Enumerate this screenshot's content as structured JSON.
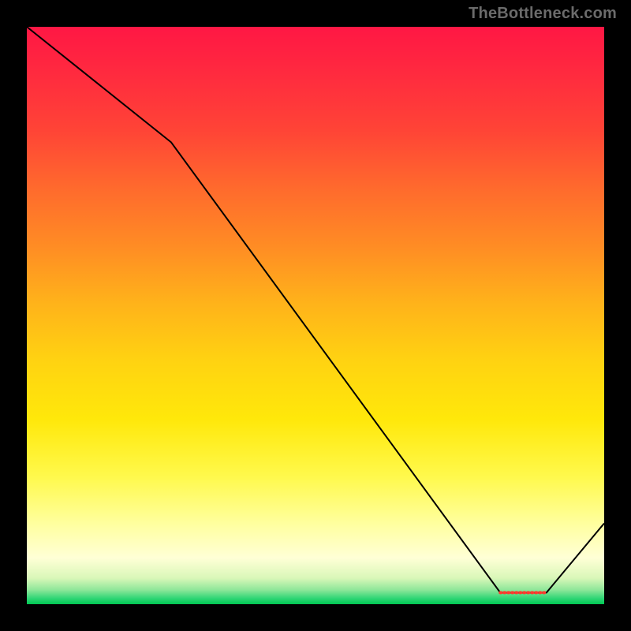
{
  "watermark": "TheBottleneck.com",
  "chart_data": {
    "type": "line",
    "title": "",
    "xlabel": "",
    "ylabel": "",
    "xlim": [
      0,
      100
    ],
    "ylim": [
      0,
      100
    ],
    "x": [
      0,
      25,
      82,
      90,
      100
    ],
    "values": [
      100,
      80,
      2,
      2,
      14
    ],
    "series_name": "bottleneck-curve",
    "flat_segment": {
      "x_start": 82,
      "x_end": 90,
      "y": 2
    },
    "gradient_stops": [
      {
        "offset": 0.0,
        "color": "#ff1744"
      },
      {
        "offset": 0.08,
        "color": "#ff2a3f"
      },
      {
        "offset": 0.18,
        "color": "#ff4436"
      },
      {
        "offset": 0.28,
        "color": "#ff6a2d"
      },
      {
        "offset": 0.38,
        "color": "#ff8c24"
      },
      {
        "offset": 0.48,
        "color": "#ffb31a"
      },
      {
        "offset": 0.58,
        "color": "#ffd311"
      },
      {
        "offset": 0.68,
        "color": "#ffe80a"
      },
      {
        "offset": 0.78,
        "color": "#fff94d"
      },
      {
        "offset": 0.86,
        "color": "#ffff9e"
      },
      {
        "offset": 0.92,
        "color": "#ffffd6"
      },
      {
        "offset": 0.955,
        "color": "#d9f7b8"
      },
      {
        "offset": 0.975,
        "color": "#8fe79a"
      },
      {
        "offset": 0.99,
        "color": "#2fd675"
      },
      {
        "offset": 1.0,
        "color": "#00c853"
      }
    ],
    "curve_stroke": "#000000",
    "curve_stroke_width": 2
  }
}
